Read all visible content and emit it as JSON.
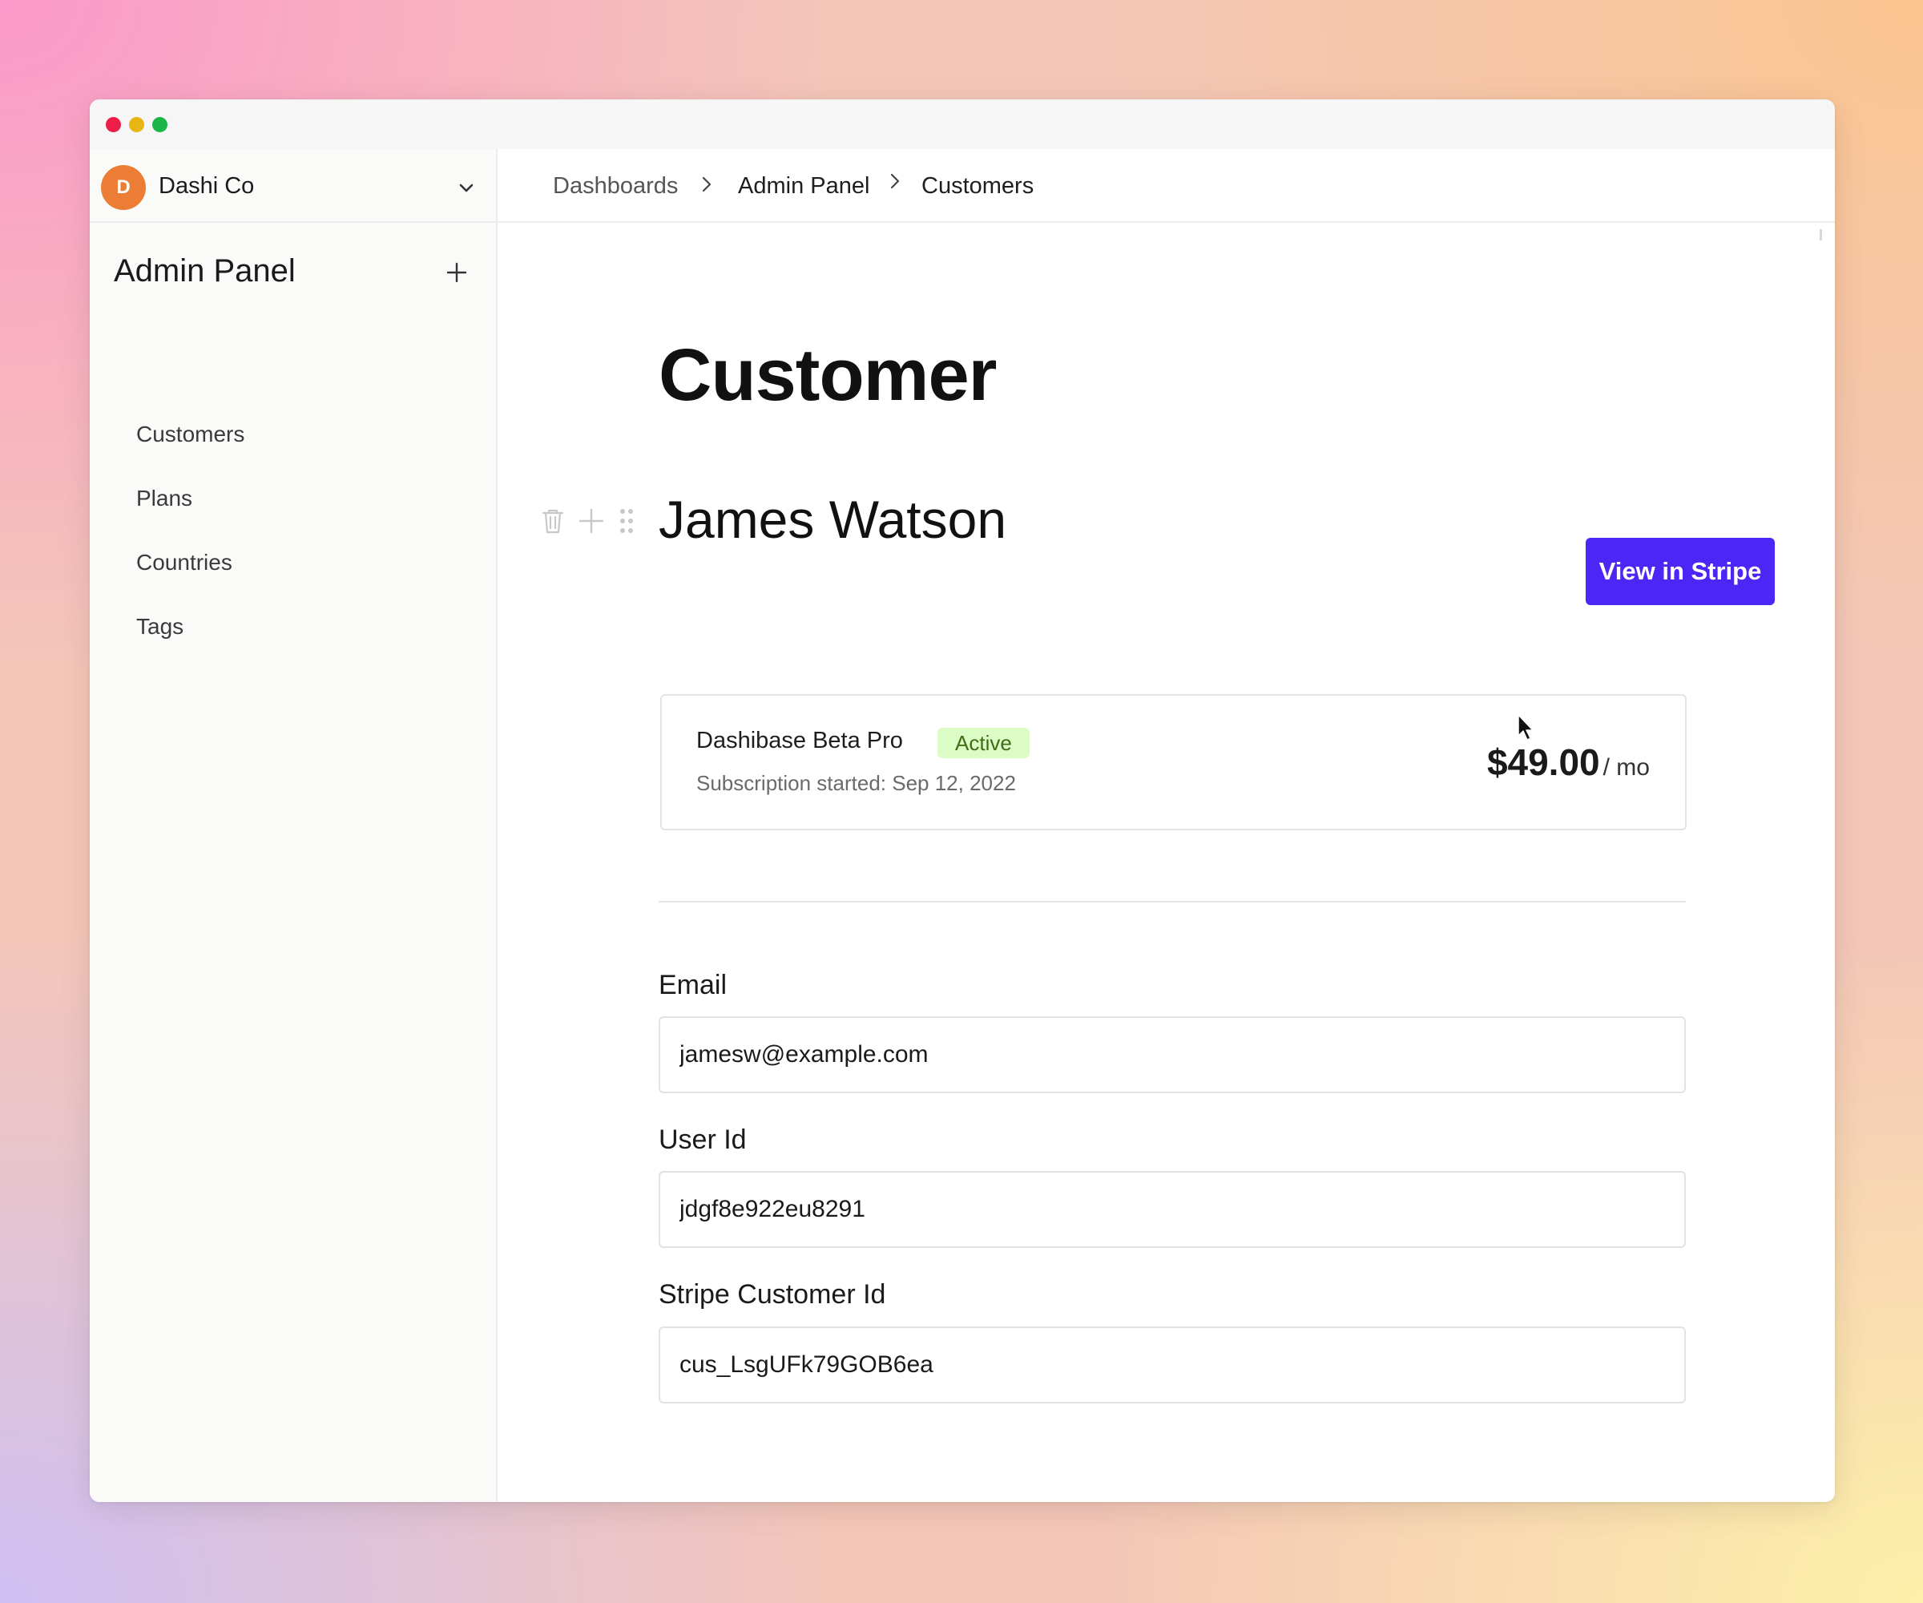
{
  "workspace": {
    "initial": "D",
    "name": "Dashi Co",
    "avatar_color": "#ec7d34"
  },
  "sidebar": {
    "title": "Admin Panel",
    "items": [
      {
        "label": "Customers"
      },
      {
        "label": "Plans"
      },
      {
        "label": "Countries"
      },
      {
        "label": "Tags"
      }
    ]
  },
  "breadcrumb": [
    "Dashboards",
    "Admin Panel",
    "Customers"
  ],
  "page": {
    "title": "Customer"
  },
  "customer": {
    "name": "James Watson",
    "action_label": "View in Stripe",
    "action_color": "#4b26f5"
  },
  "subscription": {
    "plan": "Dashibase Beta Pro",
    "status": "Active",
    "started": "Subscription started: Sep 12, 2022",
    "price": "$49.00",
    "period": "/ mo"
  },
  "fields": [
    {
      "label": "Email",
      "value": "jamesw@example.com"
    },
    {
      "label": "User Id",
      "value": "jdgf8e922eu8291"
    },
    {
      "label": "Stripe Customer Id",
      "value": "cus_LsgUFk79GOB6ea"
    }
  ],
  "icons": [
    "chevron-down-icon",
    "plus-icon",
    "chevron-right-icon",
    "trash-icon",
    "drag-handle-icon",
    "cursor-icon"
  ]
}
